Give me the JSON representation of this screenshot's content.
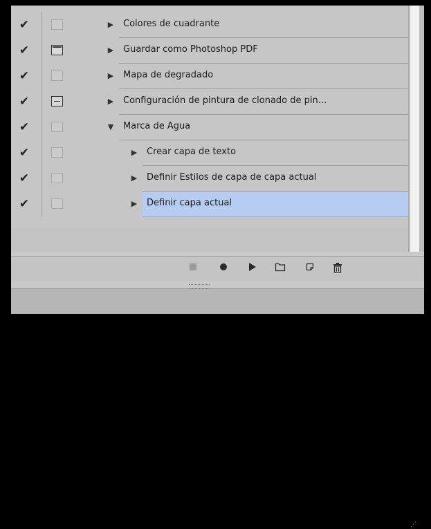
{
  "actions": {
    "rows": [
      {
        "label": "Colores de cuadrante",
        "indent": 0,
        "expanded": false,
        "selected": false,
        "toggle": "empty"
      },
      {
        "label": "Guardar como Photoshop PDF",
        "indent": 0,
        "expanded": false,
        "selected": false,
        "toggle": "dialog"
      },
      {
        "label": "Mapa de degradado",
        "indent": 0,
        "expanded": false,
        "selected": false,
        "toggle": "empty"
      },
      {
        "label": "Configuración de pintura de clonado de pin...",
        "indent": 0,
        "expanded": false,
        "selected": false,
        "toggle": "partial"
      },
      {
        "label": "Marca de Agua",
        "indent": 0,
        "expanded": true,
        "selected": false,
        "toggle": "empty"
      },
      {
        "label": "Crear capa de texto",
        "indent": 1,
        "expanded": false,
        "selected": false,
        "toggle": "empty"
      },
      {
        "label": "Definir Estilos de capa de capa actual",
        "indent": 1,
        "expanded": false,
        "selected": false,
        "toggle": "empty"
      },
      {
        "label": "Definir capa actual",
        "indent": 1,
        "expanded": false,
        "selected": true,
        "toggle": "empty"
      }
    ],
    "check_glyph": "✔",
    "arrow_collapsed": "▶",
    "arrow_expanded": "▼"
  },
  "toolbar": {
    "stop_icon": "stop-icon",
    "record_icon": "record-icon",
    "play_icon": "play-icon",
    "new_set_icon": "folder-icon",
    "new_action_icon": "new-action-icon",
    "delete_icon": "trash-icon"
  },
  "colors": {
    "selected_row": "#b6cdf3",
    "panel_bg": "#c6c6c6"
  }
}
